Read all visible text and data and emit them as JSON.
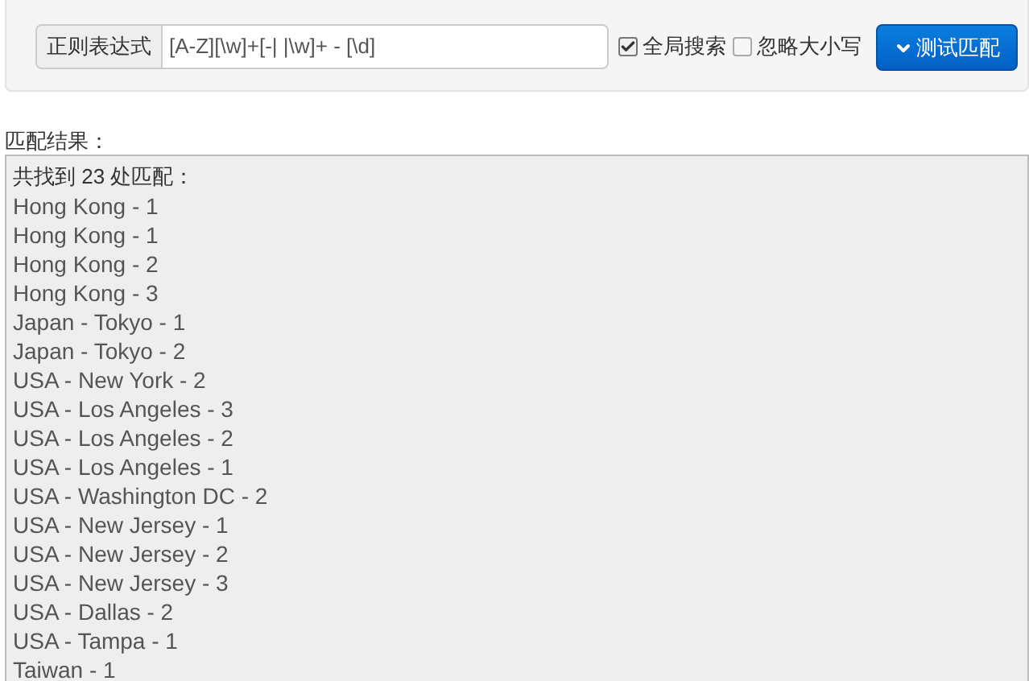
{
  "form": {
    "addon_label": "正则表达式",
    "pattern": "[A-Z][\\w]+[-| |\\w]+ - [\\d]",
    "options": [
      {
        "label": "全局搜索",
        "checked": true
      },
      {
        "label": "忽略大小写",
        "checked": false
      }
    ],
    "button": {
      "label": "测试匹配"
    }
  },
  "results": {
    "heading": "匹配结果：",
    "summary": "共找到 23 处匹配：",
    "matches": [
      "Hong Kong - 1",
      "Hong Kong - 1",
      "Hong Kong - 2",
      "Hong Kong - 3",
      "Japan - Tokyo - 1",
      "Japan - Tokyo - 2",
      "USA - New York - 2",
      "USA - Los Angeles - 3",
      "USA - Los Angeles - 2",
      "USA - Los Angeles - 1",
      "USA - Washington DC - 2",
      "USA - New Jersey - 1",
      "USA - New Jersey - 2",
      "USA - New Jersey - 3",
      "USA - Dallas - 2",
      "USA - Tampa - 1",
      "Taiwan - 1"
    ]
  }
}
